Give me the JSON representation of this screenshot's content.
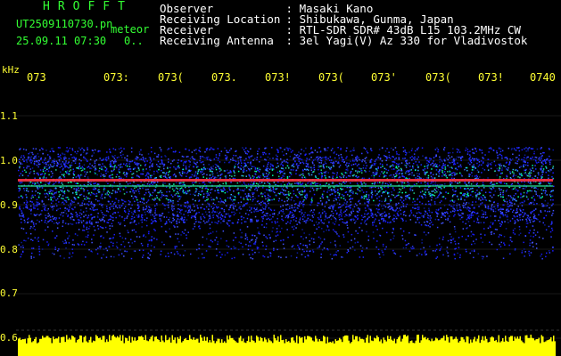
{
  "header": {
    "brand": "HROFFT",
    "filename": "UT2509110730.pn",
    "mode": "meteor",
    "datetime": "25.09.11 07:30",
    "counter": "0..",
    "info_rows": [
      {
        "label": "Observer",
        "value": "Masaki Kano"
      },
      {
        "label": "Receiving Location",
        "value": "Shibukawa, Gunma, Japan"
      },
      {
        "label": "Receiver",
        "value": "RTL-SDR SDR# 43dB L15 103.2MHz CW"
      },
      {
        "label": "Receiving Antenna",
        "value": "3el Yagi(V) Az 330 for Vladivostok"
      }
    ]
  },
  "axes": {
    "y_unit": "kHz",
    "y_ticks": [
      "1.1",
      "1.0",
      "0.9",
      "0.8",
      "0.7",
      "0.6"
    ],
    "time_ticks": [
      "073",
      "073:",
      "073(",
      "073.",
      "073!",
      "073(",
      "073'",
      "073(",
      "073!",
      "0740"
    ]
  },
  "colors": {
    "axis_text": "#ffff33",
    "brand": "#33ff33",
    "info": "#ffffff",
    "echo_line": "#ff3344",
    "noise_blue": "#1a2aff",
    "noise_green": "#22cc88",
    "amplitude": "#ffff00"
  }
}
